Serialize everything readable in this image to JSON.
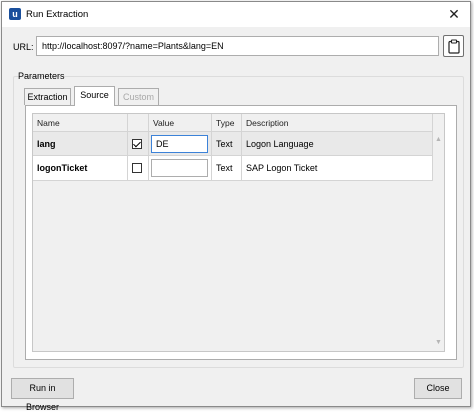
{
  "window": {
    "title": "Run Extraction",
    "close_glyph": "✕",
    "app_icon_letter": "u"
  },
  "url": {
    "label": "URL:",
    "value": "http://localhost:8097/?name=Plants&lang=EN"
  },
  "parameters": {
    "legend": "Parameters",
    "tabs": [
      {
        "label": "Extraction",
        "state": "normal"
      },
      {
        "label": "Source",
        "state": "active"
      },
      {
        "label": "Custom",
        "state": "disabled"
      }
    ],
    "grid": {
      "columns": [
        "Name",
        "",
        "Value",
        "Type",
        "Description"
      ],
      "rows": [
        {
          "name": "lang",
          "checked": true,
          "value": "DE",
          "type": "Text",
          "description": "Logon Language"
        },
        {
          "name": "logonTicket",
          "checked": false,
          "value": "",
          "type": "Text",
          "description": "SAP Logon Ticket"
        }
      ]
    }
  },
  "buttons": {
    "run_in_browser": "Run in Browser",
    "close": "Close"
  },
  "icons": {
    "app": "app-icon",
    "close": "close-icon",
    "clipboard": "clipboard-icon",
    "scroll_up": "scroll-up-icon",
    "scroll_down": "scroll-down-icon"
  },
  "colors": {
    "selected_row": "#e9e9e9",
    "focus_border": "#3c82d8",
    "app_icon": "#1a4f9c"
  }
}
